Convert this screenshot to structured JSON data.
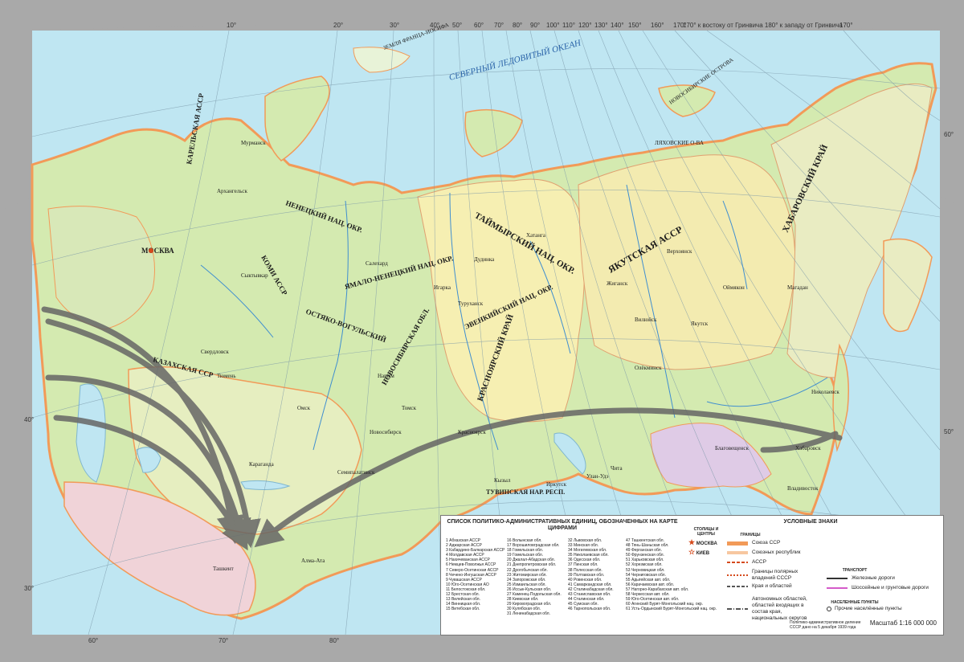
{
  "graticule": {
    "top_lon": [
      "10°",
      "20°",
      "30°",
      "40°",
      "50°",
      "60°",
      "70°",
      "80°",
      "90°",
      "100°",
      "110°",
      "120°",
      "130°",
      "140°",
      "150°",
      "160°",
      "170°"
    ],
    "meridian_note": "170° к востоку от Гринвича  180° к западу от Гринвича",
    "right_lon": "170°",
    "left_lat": [
      "40°",
      "30°"
    ],
    "right_lat": [
      "60°",
      "50°"
    ],
    "bottom_lon": [
      "60°",
      "70°",
      "80°"
    ]
  },
  "seas": [
    "СЕВЕРНЫЙ ЛЕДОВИТЫЙ ОКЕАН",
    "ЗЕМЛЯ ФРАНЦА-ИОСИФА",
    "НОВОСИБИРСКИЕ ОСТРОВА",
    "ЛЯХОВСКИЕ О-ВА"
  ],
  "regions": {
    "karelian": "КАРЕЛЬСКАЯ АССР",
    "nenets": "НЕНЕЦКИЙ НАЦ. ОКР.",
    "komi": "КОМИ АССР",
    "yamalo": "ЯМАЛО-НЕНЕЦКИЙ НАЦ. ОКР.",
    "taimyr": "ТАЙМЫРСКИЙ НАЦ. ОКР.",
    "evenki": "ЭВЕНКИЙСКИЙ НАЦ. ОКР.",
    "yakut": "ЯКУТСКАЯ АССР",
    "ostyak": "ОСТЯКО-ВОГУЛЬСКИЙ",
    "krasnoyarsk": "КРАСНОЯРСКИЙ КРАЙ",
    "novosibirsk": "НОВОСИБИРСКАЯ ОБЛ.",
    "tuva": "ТУВИНСКАЯ НАР. РЕСП.",
    "kazakh": "КАЗАХСКАЯ ССР",
    "khabarovsk": "ХАБАРОВСКИЙ КРАЙ"
  },
  "cities": [
    "МОСКВА",
    "Архангельск",
    "Мурманск",
    "Сыктывкар",
    "Салехард",
    "Дудинка",
    "Туруханск",
    "Якутск",
    "Верхоянск",
    "Жиганск",
    "Вилюйск",
    "Олёкминск",
    "Новосибирск",
    "Красноярск",
    "Омск",
    "Томск",
    "Иркутск",
    "Чита",
    "Улан-Удэ",
    "Хабаровск",
    "Владивосток",
    "Николаевск",
    "Ташкент",
    "Алма-Ата",
    "Караганда",
    "Семипалатинск",
    "Тюмень",
    "Свердловск",
    "Нарым",
    "Игарка",
    "Хатанга",
    "Оймякон",
    "Магадан",
    "Кызыл",
    "Благовещенск"
  ],
  "legend": {
    "list_title": "СПИСОК ПОЛИТИКО-АДМИНИСТРАТИВНЫХ ЕДИНИЦ, ОБОЗНАЧЕННЫХ НА КАРТЕ ЦИФРАМИ",
    "col1": [
      "1 Абхазская АССР",
      "2 Аджарская АССР",
      "3 Кабардино-Балкарская АССР",
      "4 Молдавская АССР",
      "5 Нахичеванская АССР",
      "6 Немцев-Поволжья АССР",
      "7 Северо-Осетинская АССР",
      "8 Чечено-Ингушская АССР",
      "9 Чувашская АССР",
      "10 Юго-Осетинская АО",
      "11 Белостокская обл.",
      "12 Брестская обл.",
      "13 Вилейская обл.",
      "14 Винницкая обл.",
      "15 Витебская обл."
    ],
    "col2": [
      "16 Волынская обл.",
      "17 Ворошиловградская обл.",
      "18 Гомельская обл.",
      "19 Гомельская обл.",
      "20 Джалал-Абадская обл.",
      "21 Днепропетровская обл.",
      "22 Дрогобычская обл.",
      "23 Житомирская обл.",
      "24 Запорожская обл.",
      "25 Измаильская обл.",
      "26 Иссык-Кульская обл.",
      "27 Каменец-Подольская обл.",
      "28 Киевская обл.",
      "29 Кировоградская обл.",
      "30 Кулябская обл.",
      "31 Ленинабадская обл."
    ],
    "col3": [
      "32 Львовская обл.",
      "33 Минская обл.",
      "34 Могилевская обл.",
      "35 Николаевская обл.",
      "36 Одесская обл.",
      "37 Пинская обл.",
      "38 Полесская обл.",
      "39 Полтавская обл.",
      "40 Ровенская обл.",
      "41 Самаркандская обл.",
      "42 Сталинабадская обл.",
      "43 Станиславская обл.",
      "44 Сталинская обл.",
      "45 Сумская обл.",
      "46 Тарнопольская обл."
    ],
    "col4": [
      "47 Ташкентская обл.",
      "48 Тянь-Шаньская обл.",
      "49 Ферганская обл.",
      "50 Фрунзенская обл.",
      "51 Харьковская обл.",
      "52 Хорезмская обл.",
      "53 Черновицкая обл.",
      "54 Черниговская обл.",
      "55 Адыгейская авт. обл.",
      "56 Карачаевская авт. обл.",
      "57 Нагорно-Карабахская авт. обл.",
      "58 Черкесская авт. обл.",
      "59 Юго-Осетинская авт. обл.",
      "60 Агинский Бурят-Монгольский нац. окр.",
      "61 Усть-Ордынский Бурят-Монгольский нац. окр."
    ],
    "symbols_title": "УСЛОВНЫЕ ЗНАКИ",
    "capitals_title": "СТОЛИЦЫ И ЦЕНТРЫ",
    "borders_title": "ГРАНИЦЫ",
    "capital_1": "МОСКВА",
    "capital_2": "КИЕВ",
    "border_items": [
      "Союза ССР",
      "Союзных республик",
      "АССР",
      "Границы полярных владений СССР",
      "Края и областей",
      "Автономных областей, областей входящих в состав края, национальных округов"
    ],
    "transport_title": "ТРАНСПОРТ",
    "transport_items": [
      "Железные дороги",
      "Шоссейные и грунтовые дороги"
    ],
    "settlements_title": "НАСЕЛЕННЫЕ ПУНКТЫ",
    "settlement_item": "Прочие населённые пункты",
    "note": "Политико-административное деление СССР дано на 5 декабря 1939 года",
    "scale": "Масштаб 1:16 000 000"
  },
  "colors": {
    "sea": "#bfe6f2",
    "land_green": "#cfe8a6",
    "land_yellow": "#f6efb2",
    "land_pink": "#f2c9c4",
    "land_lilac": "#dfcbe6",
    "border_orange": "#f29a58",
    "arrow": "#666666",
    "frame": "#a9a9a9"
  }
}
